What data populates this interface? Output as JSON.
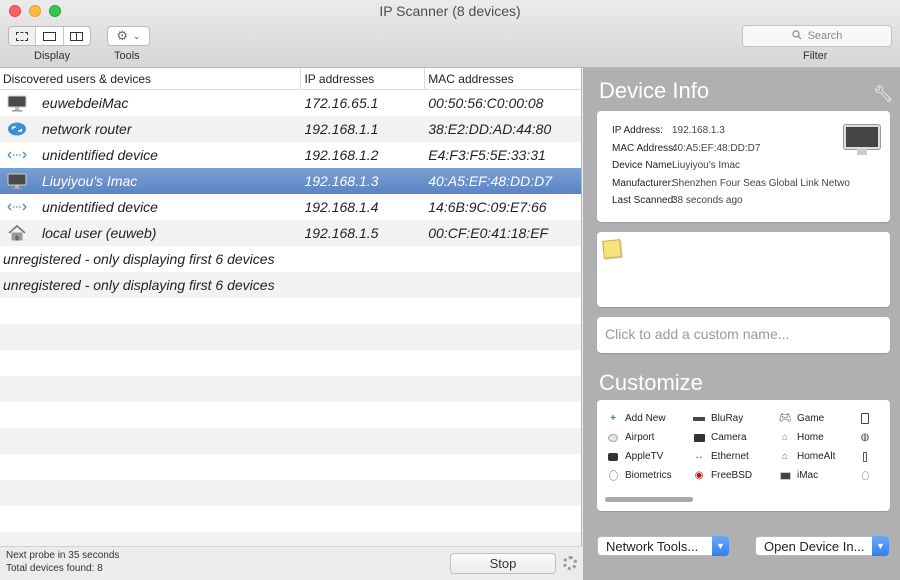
{
  "window": {
    "title": "IP Scanner (8 devices)"
  },
  "toolbar": {
    "display_label": "Display",
    "tools_label": "Tools",
    "filter_label": "Filter",
    "search_placeholder": "Search"
  },
  "table": {
    "columns": [
      "Discovered users & devices",
      "IP addresses",
      "MAC addresses"
    ],
    "rows": [
      {
        "icon": "imac-icon",
        "name": "euwebdeiMac",
        "ip": "172.16.65.1",
        "mac": "00:50:56:C0:00:08",
        "selected": false
      },
      {
        "icon": "router-icon",
        "name": "network router",
        "ip": "192.168.1.1",
        "mac": "38:E2:DD:AD:44:80",
        "selected": false
      },
      {
        "icon": "ethernet-icon",
        "name": "unidentified device",
        "ip": "192.168.1.2",
        "mac": "E4:F3:F5:5E:33:31",
        "selected": false
      },
      {
        "icon": "imac-icon",
        "name": "Liuyiyou's Imac",
        "ip": "192.168.1.3",
        "mac": "40:A5:EF:48:DD:D7",
        "selected": true
      },
      {
        "icon": "ethernet-icon",
        "name": "unidentified device",
        "ip": "192.168.1.4",
        "mac": "14:6B:9C:09:E7:66",
        "selected": false
      },
      {
        "icon": "home-icon",
        "name": "local user (euweb)",
        "ip": "192.168.1.5",
        "mac": "00:CF:E0:41:18:EF",
        "selected": false
      }
    ],
    "unregistered_messages": [
      "unregistered - only displaying first 6 devices",
      "unregistered - only displaying first 6 devices"
    ]
  },
  "status": {
    "next_probe": "Next probe in 35 seconds",
    "total_found": "Total devices found: 8",
    "stop_label": "Stop"
  },
  "device_info": {
    "title": "Device Info",
    "fields": [
      {
        "key": "IP Address:",
        "value": "192.168.1.3"
      },
      {
        "key": "MAC Address:",
        "value": "40:A5:EF:48:DD:D7"
      },
      {
        "key": "Device Name:",
        "value": "Liuyiyou's Imac"
      },
      {
        "key": "Manufacturer:",
        "value": "Shenzhen Four Seas Global Link Netwo"
      },
      {
        "key": "Last Scanned:",
        "value": "38 seconds ago"
      }
    ],
    "custom_name_placeholder": "Click to add a custom name..."
  },
  "customize": {
    "title": "Customize",
    "columns": [
      [
        {
          "icon": "plus-icon",
          "label": "Add New"
        },
        {
          "icon": "airport-icon",
          "label": "Airport"
        },
        {
          "icon": "appletv-icon",
          "label": "AppleTV"
        },
        {
          "icon": "fingerprint-icon",
          "label": "Biometrics"
        }
      ],
      [
        {
          "icon": "bluray-icon",
          "label": "BluRay"
        },
        {
          "icon": "camera-icon",
          "label": "Camera"
        },
        {
          "icon": "ethernet-icon",
          "label": "Ethernet"
        },
        {
          "icon": "freebsd-icon",
          "label": "FreeBSD"
        }
      ],
      [
        {
          "icon": "gamepad-icon",
          "label": "Game"
        },
        {
          "icon": "home-icon",
          "label": "Home"
        },
        {
          "icon": "home-alt-icon",
          "label": "HomeAlt"
        },
        {
          "icon": "imac-icon",
          "label": "iMac"
        }
      ],
      [
        {
          "icon": "ipad-icon",
          "label": ""
        },
        {
          "icon": "speaker-icon",
          "label": ""
        },
        {
          "icon": "iphone-icon",
          "label": ""
        },
        {
          "icon": "lightbulb-icon",
          "label": ""
        }
      ]
    ]
  },
  "bottom_buttons": {
    "network_tools": "Network Tools...",
    "open_device": "Open Device In..."
  },
  "colors": {
    "selection": "#5b84c4",
    "panel_bg": "#b0b0b2",
    "popup_arrow": "#2d7ef0"
  }
}
